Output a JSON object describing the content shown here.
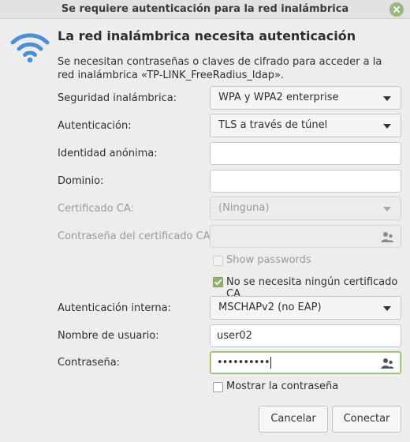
{
  "window": {
    "title": "Se requiere autenticación para la red inalámbrica"
  },
  "dialog": {
    "heading": "La red inalámbrica necesita autenticación",
    "description": "Se necesitan contraseñas o claves de cifrado para acceder a la red inalámbrica «TP-LINK_FreeRadius_ldap»."
  },
  "form": {
    "security": {
      "label": "Seguridad inalámbrica:",
      "value": "WPA y WPA2 enterprise"
    },
    "authentication": {
      "label": "Autenticación:",
      "value": "TLS a través de túnel"
    },
    "anonymous_identity": {
      "label": "Identidad anónima:",
      "value": ""
    },
    "domain": {
      "label": "Dominio:",
      "value": ""
    },
    "ca_certificate": {
      "label": "Certificado CA:",
      "value": "(Ninguna)"
    },
    "ca_password": {
      "label": "Contraseña del certificado CA:",
      "value": ""
    },
    "show_passwords": {
      "label": "Show passwords",
      "checked": false,
      "disabled": true
    },
    "no_ca_required": {
      "label": "No se necesita ningún certificado CA",
      "checked": true
    },
    "inner_auth": {
      "label": "Autenticación interna:",
      "value": "MSCHAPv2 (no EAP)"
    },
    "username": {
      "label": "Nombre de usuario:",
      "value": "user02"
    },
    "password": {
      "label": "Contraseña:",
      "value": "••••••••••"
    },
    "show_password": {
      "label": "Mostrar la contraseña",
      "checked": false
    }
  },
  "buttons": {
    "cancel": "Cancelar",
    "connect": "Conectar"
  },
  "colors": {
    "accent": "#8fb56b",
    "wifi": "#4a90d9"
  },
  "icons": {
    "close": "close-icon",
    "wifi": "wifi-icon",
    "user": "user-icon",
    "check": "checkmark-icon"
  }
}
